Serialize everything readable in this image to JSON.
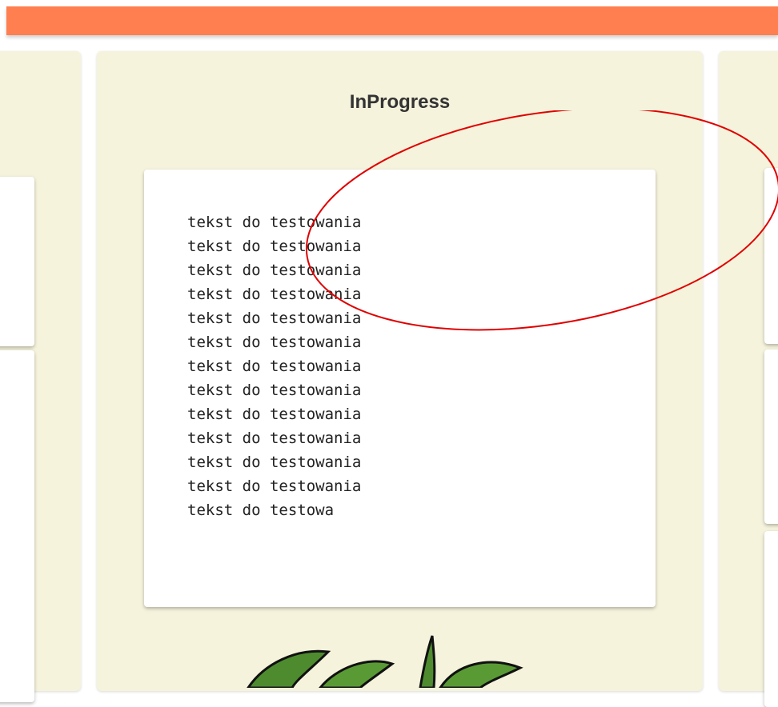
{
  "header": {
    "color": "#ff7f50"
  },
  "columns": [
    {
      "id": "left",
      "title": ""
    },
    {
      "id": "middle",
      "title": "InProgress",
      "cards": [
        {
          "lines": [
            "tekst do testowania",
            "tekst do testowania",
            "tekst do testowania",
            "tekst do testowania",
            "tekst do testowania",
            "tekst do testowania",
            "tekst do testowania",
            "tekst do testowania",
            "tekst do testowania",
            "tekst do testowania",
            "tekst do testowania",
            "tekst do testowania",
            "tekst do testowa"
          ]
        }
      ]
    },
    {
      "id": "right",
      "title": ""
    }
  ],
  "colors": {
    "column_bg": "#f5f3dc",
    "annotation": "#e00000"
  },
  "icons": {
    "bottom_graphic": "plant-leaves-icon",
    "annotation": "red-ellipse-annotation"
  }
}
